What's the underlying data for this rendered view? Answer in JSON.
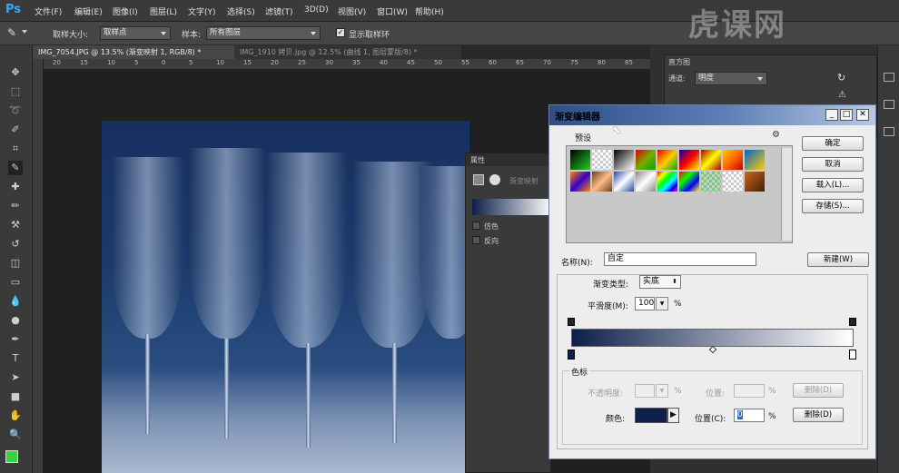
{
  "app": {
    "logo": "Ps"
  },
  "menu": [
    "文件(F)",
    "编辑(E)",
    "图像(I)",
    "图层(L)",
    "文字(Y)",
    "选择(S)",
    "滤镜(T)",
    "3D(D)",
    "视图(V)",
    "窗口(W)",
    "帮助(H)"
  ],
  "options": {
    "sample_size_label": "取样大小:",
    "sample_size_value": "取样点",
    "sample_label": "样本:",
    "sample_value": "所有图层",
    "show_ring_label": "显示取样环"
  },
  "tabs": [
    {
      "label": "IMG_7054.JPG @ 13.5% (渐变映射 1, RGB/8) *"
    },
    {
      "label": "IMG_1910 拷贝.jpg @ 12.5% (曲线 1, 图层蒙版/8) *"
    }
  ],
  "ruler_marks": [
    "20",
    "15",
    "10",
    "5",
    "0",
    "5",
    "10",
    "15",
    "20",
    "25",
    "30",
    "35",
    "40",
    "45",
    "50",
    "55",
    "60",
    "65",
    "70",
    "75",
    "80",
    "85"
  ],
  "properties_panel": {
    "title": "属性",
    "layer_type": "渐变映射",
    "dither_label": "仿色",
    "reverse_label": "反向"
  },
  "histogram_panel": {
    "title": "直方图",
    "channel_label": "通道:",
    "channel_value": "明度"
  },
  "gradient_editor": {
    "title": "渐变编辑器",
    "presets_label": "预设",
    "ok_button": "确定",
    "cancel_button": "取消",
    "load_button": "载入(L)...",
    "save_button": "存储(S)...",
    "name_label": "名称(N):",
    "name_value": "自定",
    "new_button": "新建(W)",
    "gradient_type_label": "渐变类型:",
    "gradient_type_value": "实底",
    "smoothness_label": "平滑度(M):",
    "smoothness_value": "100",
    "smoothness_unit": "%",
    "stops_group_label": "色标",
    "opacity_label": "不透明度:",
    "opacity_unit": "%",
    "opacity_location_label": "位置:",
    "opacity_location_unit": "%",
    "opacity_delete_button": "删除(D)",
    "color_label": "颜色:",
    "color_location_label": "位置(C):",
    "color_location_value": "0",
    "color_location_unit": "%",
    "color_delete_button": "删除(D)",
    "gradient_start_color": "#0d1f4a",
    "gradient_end_color": "#ffffff",
    "current_stop_color": "#0d1f4a"
  },
  "watermark": "虎课网"
}
